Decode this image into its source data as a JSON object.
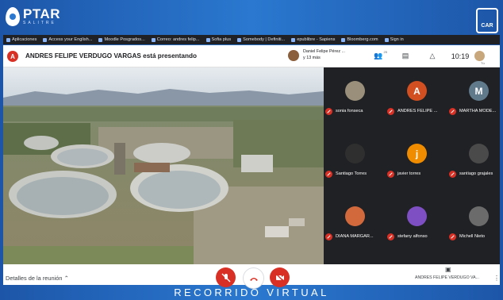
{
  "header": {
    "logo_main": "PTAR",
    "logo_sub": "SALITRE",
    "right_logo": "CAR"
  },
  "bookmarks": [
    "Aplicaciones",
    "Access your English...",
    "Moodle Posgrados...",
    "Correo: andres felip...",
    "Sofia plus",
    "Somebody | Definiti...",
    "epublibre - Sapiens",
    "Bloomberg.com",
    "Sign in"
  ],
  "presenter": {
    "initial": "A",
    "text": "ANDRES FELIPE VERDUGO VARGAS está presentando",
    "other_name": "Daniel Felipe Pérez ...",
    "other_more": "y 13 más"
  },
  "toolbar": {
    "participants_icon": "people-icon",
    "participant_count": "25",
    "chat_icon": "chat-icon",
    "activities_icon": "shapes-icon",
    "time": "10:19",
    "self_label": "Tú"
  },
  "participants": [
    {
      "name": "sonia fonseca",
      "initial": "",
      "color": "#9a8f7a"
    },
    {
      "name": "ANDRES FELIPE ...",
      "initial": "A",
      "color": "#d14f20"
    },
    {
      "name": "MARTHA MODE...",
      "initial": "M",
      "color": "#607a8c"
    },
    {
      "name": "Santiago Torres",
      "initial": "",
      "color": "#2f2f2f"
    },
    {
      "name": "javier torres",
      "initial": "j",
      "color": "#f08c00"
    },
    {
      "name": "santiago grajales",
      "initial": "",
      "color": "#4a4a4a"
    },
    {
      "name": "DIANA MARGAR...",
      "initial": "",
      "color": "#d2693c"
    },
    {
      "name": "stefany alfonso",
      "initial": "",
      "color": "#7d4fc2"
    },
    {
      "name": "Michell Nieto",
      "initial": "",
      "color": "#6b6b6b"
    }
  ],
  "bottom": {
    "details": "Detalles de la reunión",
    "presenting_name": "ANDRES FELIPE VERDUGO VA..."
  },
  "caption": "RECORRIDO VIRTUAL",
  "colors": {
    "brand_blue": "#2a78d0",
    "meet_red": "#d93025",
    "meet_dark": "#202124"
  }
}
